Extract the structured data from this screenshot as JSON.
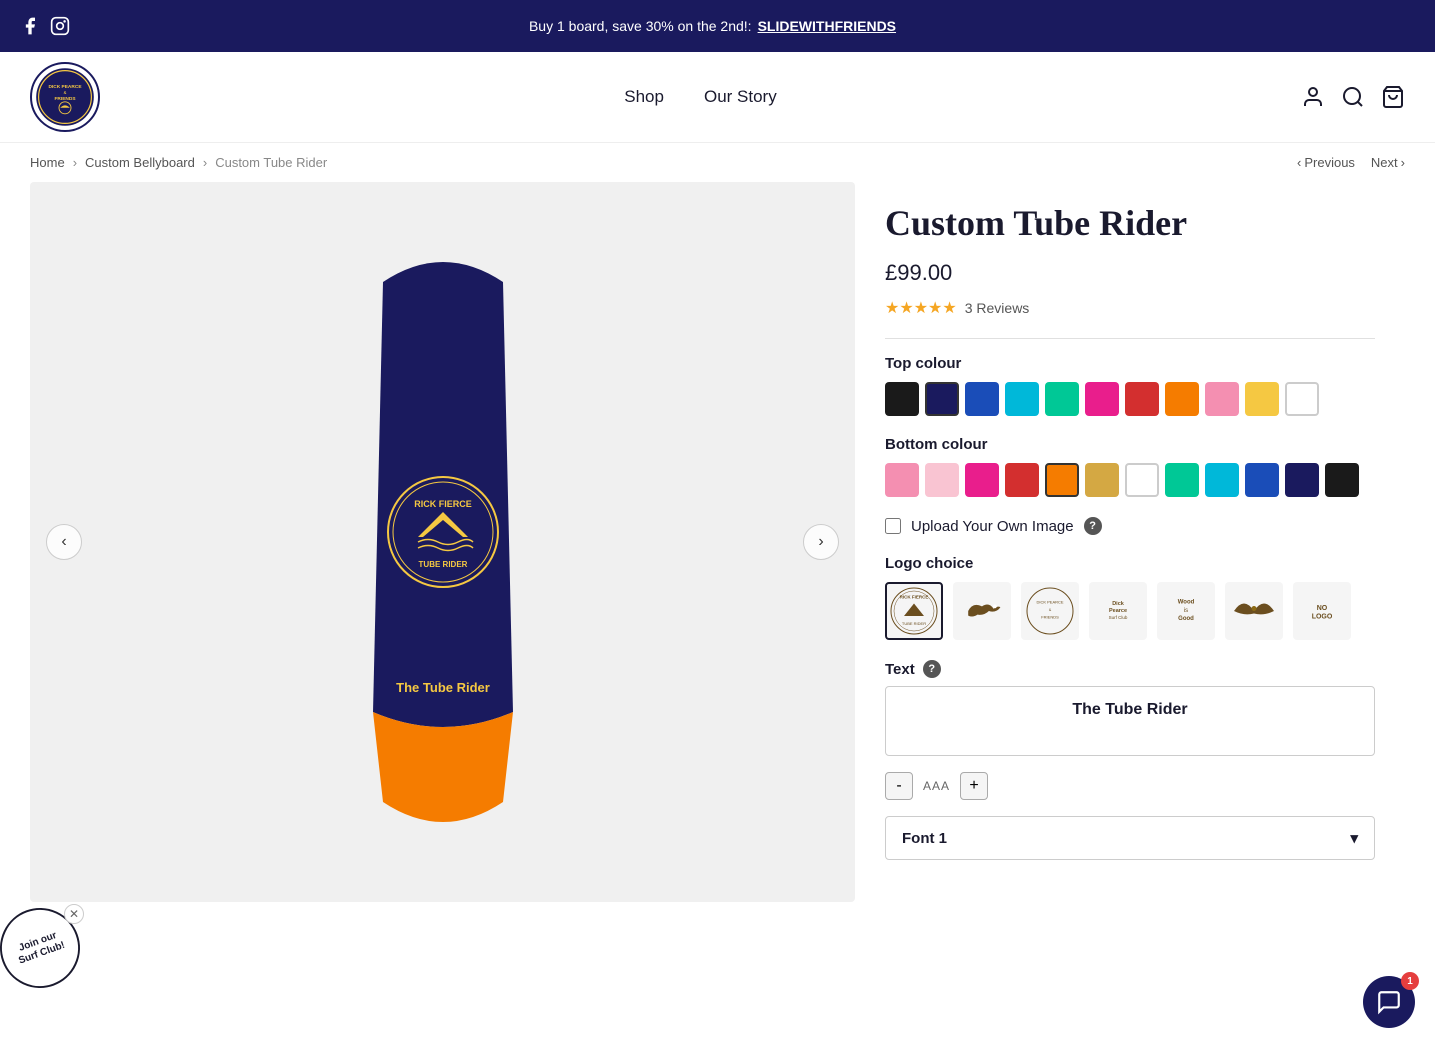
{
  "announcement": {
    "text": "Buy 1 board, save 30% on the 2nd!: ",
    "link_text": "SLIDEWITHFRIENDS",
    "link_href": "#"
  },
  "header": {
    "logo_alt": "Dick Pearce & Friends",
    "nav_items": [
      {
        "label": "Shop",
        "href": "#"
      },
      {
        "label": "Our Story",
        "href": "#"
      }
    ]
  },
  "breadcrumb": {
    "items": [
      {
        "label": "Home",
        "href": "#"
      },
      {
        "label": "Custom Bellyboard",
        "href": "#"
      },
      {
        "label": "Custom Tube Rider",
        "href": "#"
      }
    ],
    "previous_label": "Previous",
    "next_label": "Next"
  },
  "product": {
    "title": "Custom Tube Rider",
    "price": "£99.00",
    "rating": 5,
    "reviews_count": "3 Reviews",
    "top_colour_label": "Top colour",
    "top_colours": [
      {
        "hex": "#1a1a1a",
        "name": "black"
      },
      {
        "hex": "#1a1a5e",
        "name": "navy"
      },
      {
        "hex": "#1a4db8",
        "name": "blue"
      },
      {
        "hex": "#00b8d9",
        "name": "cyan"
      },
      {
        "hex": "#00c896",
        "name": "teal"
      },
      {
        "hex": "#e91e8c",
        "name": "pink-hot"
      },
      {
        "hex": "#d32f2f",
        "name": "red"
      },
      {
        "hex": "#f57c00",
        "name": "orange"
      },
      {
        "hex": "#f48fb1",
        "name": "pink-light"
      },
      {
        "hex": "#f5c842",
        "name": "gold"
      },
      {
        "hex": "#ffffff",
        "name": "white"
      }
    ],
    "selected_top_colour": "navy",
    "bottom_colour_label": "Bottom colour",
    "bottom_colours": [
      {
        "hex": "#f48fb1",
        "name": "pink-med"
      },
      {
        "hex": "#f9c4d2",
        "name": "pink-pale"
      },
      {
        "hex": "#e91e8c",
        "name": "pink-hot"
      },
      {
        "hex": "#d32f2f",
        "name": "red"
      },
      {
        "hex": "#f57c00",
        "name": "orange",
        "selected": true
      },
      {
        "hex": "#d4a843",
        "name": "gold"
      },
      {
        "hex": "#ffffff",
        "name": "white"
      },
      {
        "hex": "#00c896",
        "name": "teal"
      },
      {
        "hex": "#00b8d9",
        "name": "cyan"
      },
      {
        "hex": "#1a4db8",
        "name": "blue"
      },
      {
        "hex": "#1a1a5e",
        "name": "navy"
      },
      {
        "hex": "#1a1a1a",
        "name": "black"
      }
    ],
    "selected_bottom_colour": "orange",
    "upload_label": "Upload Your Own Image",
    "logo_choice_label": "Logo choice",
    "logos": [
      {
        "id": "tube-rider",
        "label": "Rick Fierce Tube Rider",
        "selected": true
      },
      {
        "id": "bird",
        "label": "Bird"
      },
      {
        "id": "dp-friends",
        "label": "Dick Pearce & Friends"
      },
      {
        "id": "surf-club",
        "label": "Dick Pearce Surf Club"
      },
      {
        "id": "wood-is-good",
        "label": "Wood Is Good"
      },
      {
        "id": "swallow",
        "label": "Swallow"
      },
      {
        "id": "no-logo",
        "label": "No Logo"
      }
    ],
    "text_label": "Text",
    "text_value": "The Tube Rider",
    "text_placeholder": "The Tube Rider",
    "font_decrease": "-",
    "font_size_label": "AAA",
    "font_increase": "+",
    "font_select_label": "Font 1"
  },
  "surf_club": {
    "text": "Join our\nSurf Club!"
  },
  "chat": {
    "badge": "1"
  }
}
